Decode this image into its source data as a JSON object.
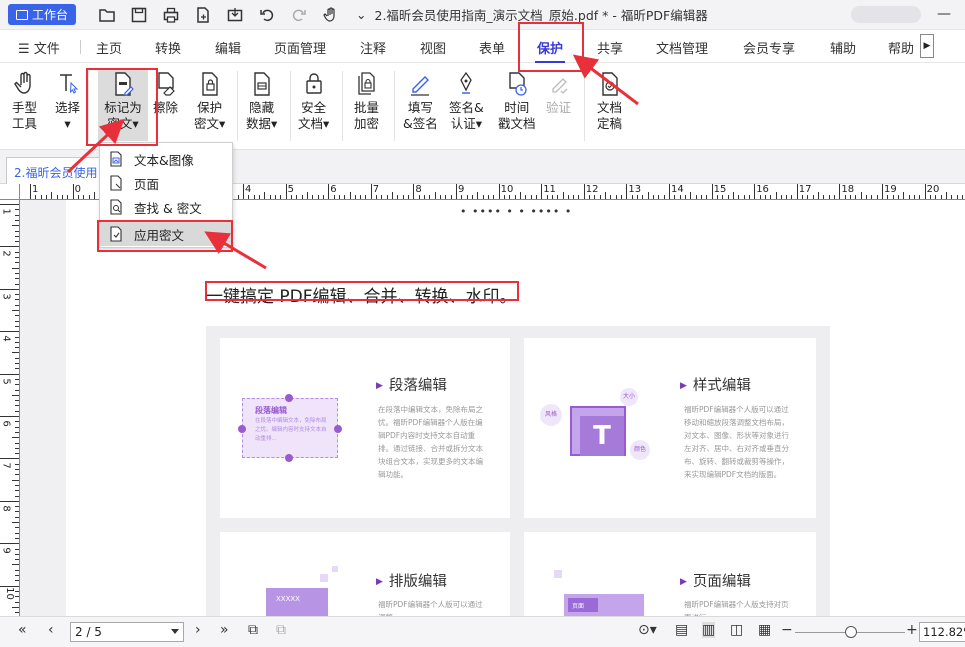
{
  "titlebar": {
    "workbench": "工作台",
    "doc_title": "2.福昕会员使用指南_演示文档_原始.pdf * - 福昕PDF编辑器"
  },
  "menu": {
    "file": "文件",
    "items": [
      "主页",
      "转换",
      "编辑",
      "页面管理",
      "注释",
      "视图",
      "表单",
      "保护",
      "共享",
      "文档管理",
      "会员专享",
      "辅助",
      "帮助"
    ],
    "active": "保护"
  },
  "ribbon": {
    "hand_tool": [
      "手型",
      "工具"
    ],
    "select": [
      "选择"
    ],
    "mark_redact": [
      "标记为",
      "密文▾"
    ],
    "erase": [
      "擦除"
    ],
    "protect_redact": [
      "保护",
      "密文▾"
    ],
    "hide_data": [
      "隐藏",
      "数据▾"
    ],
    "secure_doc": [
      "安全",
      "文档▾"
    ],
    "batch_encrypt": [
      "批量",
      "加密"
    ],
    "fill_sign": [
      "填写",
      "&签名"
    ],
    "sign_cert": [
      "签名&",
      "认证▾"
    ],
    "timestamp": [
      "时间",
      "戳文档"
    ],
    "verify": [
      "验证"
    ],
    "finalize": [
      "文档",
      "定稿"
    ]
  },
  "tab": {
    "label": "2.福昕会员使用"
  },
  "dropdown": {
    "items": [
      "文本&图像",
      "页面",
      "查找 & 密文",
      "应用密文"
    ]
  },
  "ruler": {
    "h": [
      "1",
      "0",
      "1",
      "2",
      "3",
      "4",
      "5",
      "6",
      "7",
      "8",
      "9",
      "10",
      "11",
      "12",
      "13",
      "14",
      "15",
      "16",
      "17",
      "18",
      "19",
      "20"
    ],
    "v": [
      "1",
      "2",
      "3",
      "4",
      "5",
      "6",
      "7",
      "8",
      "9",
      "10"
    ]
  },
  "document": {
    "dots": "• •••• • • •••• •",
    "headline": "一键搞定 PDF编辑、合并、转换、水印。",
    "cards": [
      {
        "title": "段落编辑",
        "text": "在段落中编辑文本，免除布局之忧。福昕PDF编辑器个人版在编辑PDF内容时支持文本自动重排。通过链接、合并或拆分文本块组合文本，实现更多的文本编辑功能。",
        "illus_title": "段落编辑",
        "illus_text": "在段落中编辑文本，免除布局之忧。编辑内容时支持文本自动重排..."
      },
      {
        "title": "样式编辑",
        "text": "福昕PDF编辑器个人版可以通过移动和缩放段落调整文档布局，对文本、图像、形状等对象进行左对齐、居中、右对齐或垂直分布、旋转、翻转或裁剪等操作，来实现编辑PDF文档的版面。",
        "illus_tags": [
          "大小",
          "风格",
          "颜色"
        ],
        "illus_letter": "T"
      },
      {
        "title": "排版编辑",
        "text": "福昕PDF编辑器个人版可以通过调整",
        "illus_text": "XXXXX"
      },
      {
        "title": "页面编辑",
        "text": "福昕PDF编辑器个人版支持对页面进行",
        "illus_text": "页面"
      }
    ]
  },
  "bottombar": {
    "page": "2 / 5",
    "zoom": "112.82%"
  },
  "colors": {
    "accent": "#3a3ad6",
    "workbench": "#3a64e8",
    "annotation": "#e8303a",
    "purple": "#7a3ab8"
  }
}
